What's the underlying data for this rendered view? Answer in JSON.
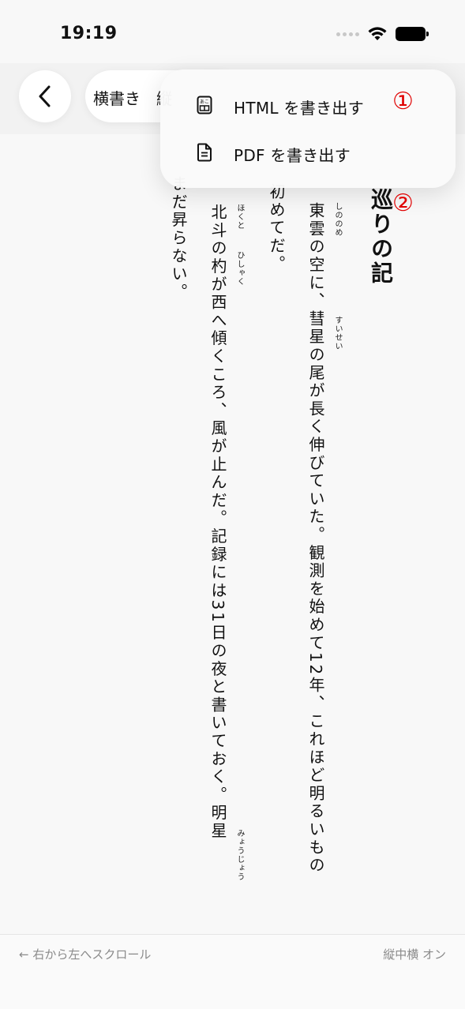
{
  "status_bar": {
    "time": "19:19"
  },
  "toolbar": {
    "segment_horizontal": "横書き",
    "segment_vertical": "縦"
  },
  "menu": {
    "items": [
      {
        "label": "HTML を書き出す",
        "icon": "html-export-icon",
        "marker": "①"
      },
      {
        "label": "PDF を書き出す",
        "icon": "document-icon",
        "marker": "②"
      }
    ]
  },
  "content": {
    "title": "巡りの記",
    "columns": [
      "東雲の空に、彗星の尾が長く伸びていた。観測を始めて12年、これほど明るいもの",
      "初めてだ。",
      "北斗の杓が西へ傾くころ、風が止んだ。記録には31日の夜と書いておく。明星",
      "まだ昇らない。"
    ],
    "ruby": [
      "しののめ",
      "すいせい",
      "ほくと",
      "ひしゃく",
      "みょうじょう"
    ]
  },
  "footer": {
    "left": "← 右から左へスクロール",
    "right": "縦中横 オン"
  }
}
